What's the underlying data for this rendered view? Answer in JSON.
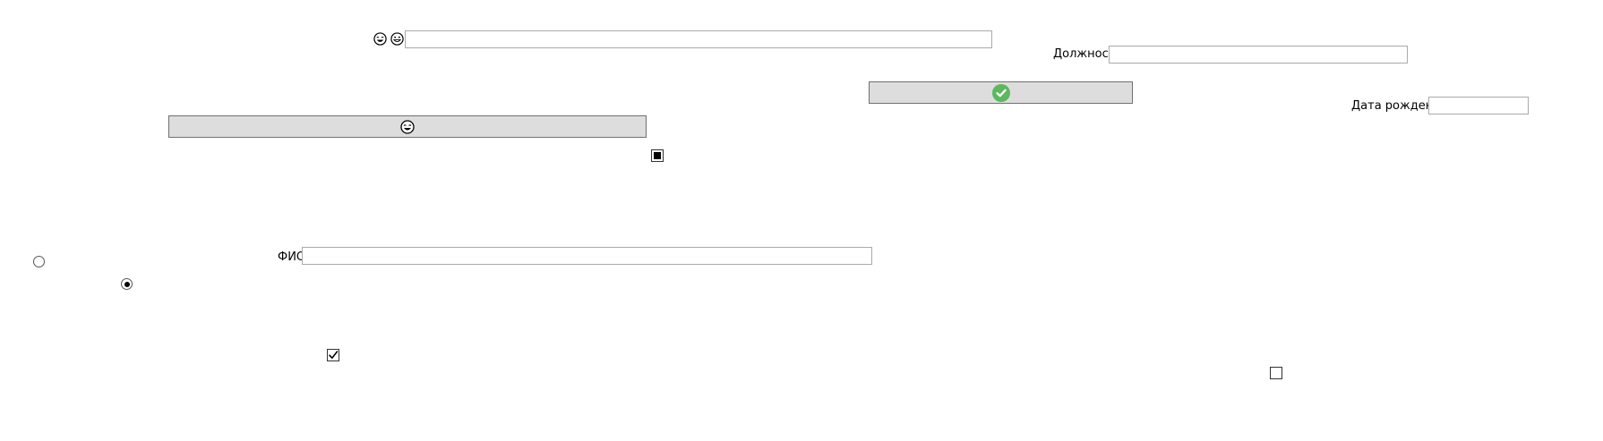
{
  "top_field": {
    "value": "",
    "icons": [
      "laughing-face-icon",
      "grinning-face-icon"
    ]
  },
  "position_field": {
    "label": "Должность",
    "value": ""
  },
  "confirm_button": {
    "icon": "check-circle-icon",
    "accent_color": "#5cb85c"
  },
  "birthdate_field": {
    "label": "Дата рождения",
    "value": ""
  },
  "emoji_button": {
    "icon": "laughing-face-icon"
  },
  "checkboxes": [
    {
      "name": "checkbox-indeterminate",
      "state": "indeterminate"
    },
    {
      "name": "checkbox-checked",
      "state": "checked"
    },
    {
      "name": "checkbox-unchecked",
      "state": "unchecked"
    }
  ],
  "fio_field": {
    "label": "ФИО",
    "value": ""
  },
  "radios": [
    {
      "name": "radio-unselected",
      "selected": false
    },
    {
      "name": "radio-selected",
      "selected": true
    }
  ]
}
